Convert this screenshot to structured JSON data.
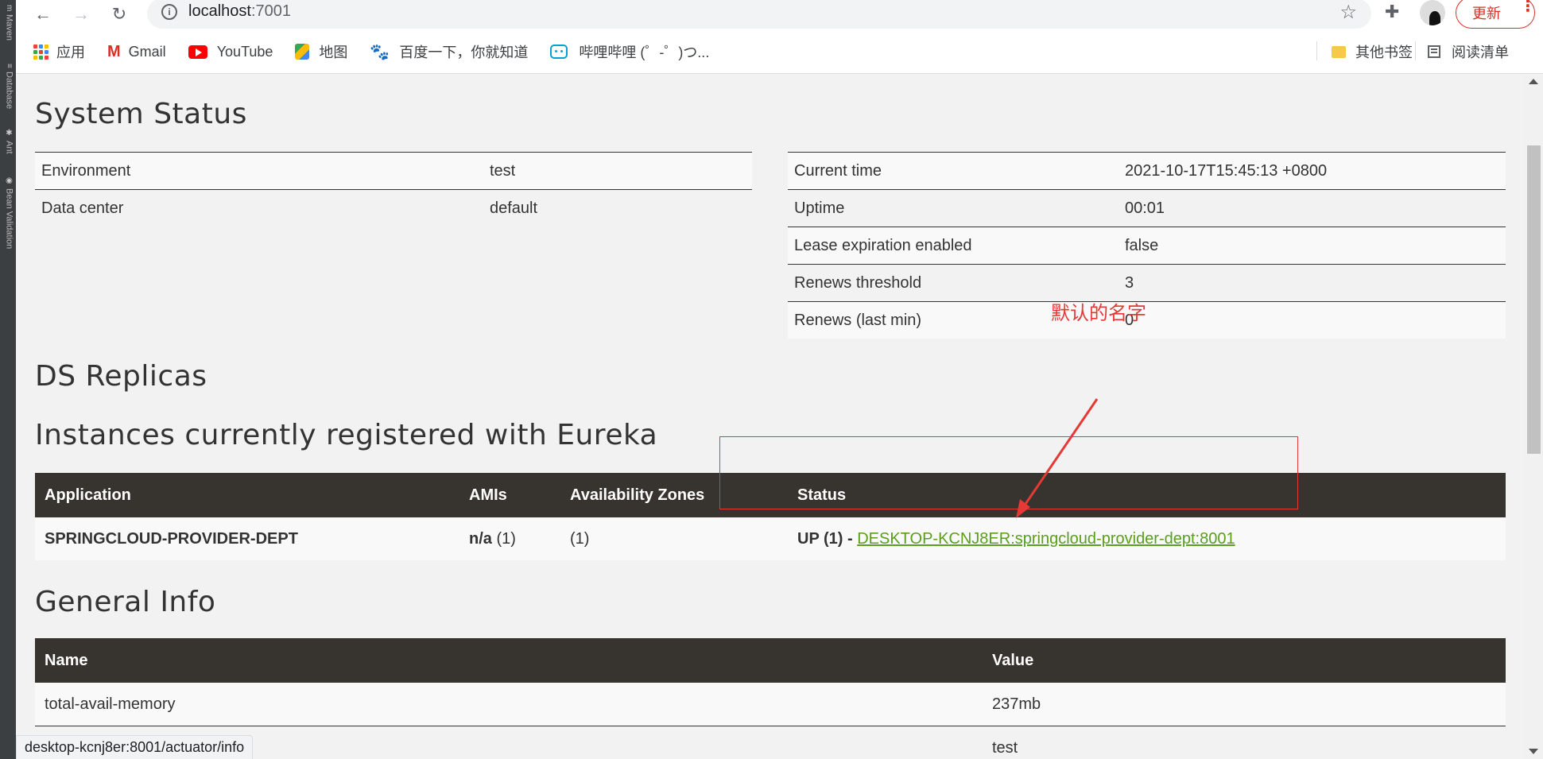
{
  "ide": {
    "tabs": [
      {
        "label": "Maven",
        "icon": "maven-icon"
      },
      {
        "label": "Database",
        "icon": "database-icon"
      },
      {
        "label": "Ant",
        "icon": "ant-icon"
      },
      {
        "label": "Bean Validation",
        "icon": "bean-validation-icon"
      }
    ]
  },
  "browser": {
    "url_host": "localhost",
    "url_port": ":7001",
    "update_label": "更新",
    "bookmarks": [
      {
        "label": "应用",
        "icon": "apps-icon"
      },
      {
        "label": "Gmail",
        "icon": "gmail-icon"
      },
      {
        "label": "YouTube",
        "icon": "youtube-icon"
      },
      {
        "label": "地图",
        "icon": "maps-icon"
      },
      {
        "label": "百度一下，你就知道",
        "icon": "baidu-icon"
      },
      {
        "label": "哔哩哔哩 (゜-゜)つ...",
        "icon": "bilibili-icon"
      }
    ],
    "other_bookmarks": "其他书签",
    "reading_list": "阅读清单"
  },
  "system_status": {
    "heading": "System Status",
    "left": [
      {
        "key": "Environment",
        "value": "test"
      },
      {
        "key": "Data center",
        "value": "default"
      }
    ],
    "right": [
      {
        "key": "Current time",
        "value": "2021-10-17T15:45:13 +0800"
      },
      {
        "key": "Uptime",
        "value": "00:01"
      },
      {
        "key": "Lease expiration enabled",
        "value": "false"
      },
      {
        "key": "Renews threshold",
        "value": "3"
      },
      {
        "key": "Renews (last min)",
        "value": "0"
      }
    ]
  },
  "ds_replicas": {
    "heading": "DS Replicas"
  },
  "instances": {
    "heading": "Instances currently registered with Eureka",
    "columns": [
      "Application",
      "AMIs",
      "Availability Zones",
      "Status"
    ],
    "rows": [
      {
        "application": "SPRINGCLOUD-PROVIDER-DEPT",
        "amis_bold": "n/a",
        "amis_count": " (1)",
        "zones": "(1)",
        "status_prefix": "UP (1) - ",
        "status_link": "DESKTOP-KCNJ8ER:springcloud-provider-dept:8001"
      }
    ]
  },
  "annotation": {
    "text": "默认的名字",
    "color": "#e53935"
  },
  "general_info": {
    "heading": "General Info",
    "columns": [
      "Name",
      "Value"
    ],
    "rows": [
      {
        "name": "total-avail-memory",
        "value": "237mb"
      },
      {
        "name": "",
        "value": "test"
      }
    ]
  },
  "status_bar": {
    "text": "desktop-kcnj8er:8001/actuator/info"
  },
  "colors": {
    "header_bg": "#37332f",
    "link": "#5a9e1c",
    "page_bg": "#f2f2f2"
  }
}
